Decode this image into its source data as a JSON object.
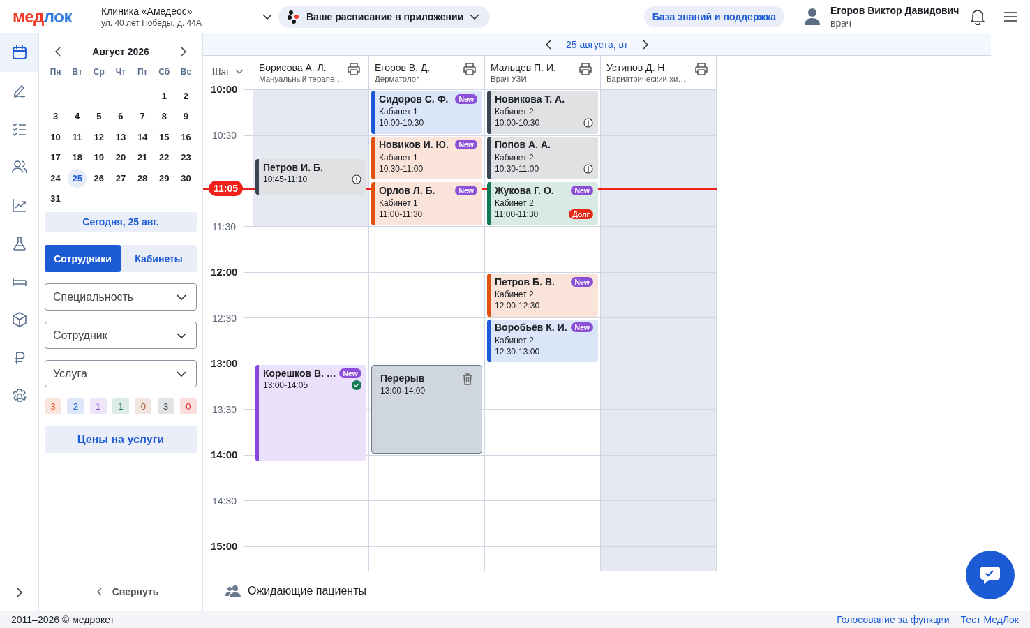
{
  "header": {
    "logo": {
      "first": "мед",
      "second": "лок"
    },
    "clinic": {
      "name": "Клиника «Амедеос»",
      "address": "ул. 40 лет Победы, д. 44А"
    },
    "app_promo": "Ваше расписание в приложении",
    "help": "База знаний и поддержка",
    "user": {
      "name": "Егоров Виктор Давидович",
      "role": "врач"
    }
  },
  "nav": [
    {
      "selected": true
    },
    {
      "selected": false
    },
    {
      "selected": false
    },
    {
      "selected": false
    },
    {
      "selected": false
    },
    {
      "selected": false
    },
    {
      "selected": false
    },
    {
      "selected": false
    },
    {
      "selected": false
    },
    {
      "selected": false
    }
  ],
  "calendar": {
    "month": "Август 2026",
    "weekdays": [
      "Пн",
      "Вт",
      "Ср",
      "Чт",
      "Пт",
      "Сб",
      "Вс"
    ],
    "weeks": [
      [
        {
          "day": "1",
          "selected": false
        },
        {
          "day": "2",
          "selected": false
        }
      ],
      [
        {
          "day": "3",
          "selected": false
        },
        {
          "day": "4",
          "selected": false
        },
        {
          "day": "5",
          "selected": false
        },
        {
          "day": "6",
          "selected": false
        },
        {
          "day": "7",
          "selected": false
        },
        {
          "day": "8",
          "selected": false
        },
        {
          "day": "9",
          "selected": false
        }
      ],
      [
        {
          "day": "10",
          "selected": false
        },
        {
          "day": "11",
          "selected": false
        },
        {
          "day": "12",
          "selected": false
        },
        {
          "day": "13",
          "selected": false
        },
        {
          "day": "14",
          "selected": false
        },
        {
          "day": "15",
          "selected": false
        },
        {
          "day": "16",
          "selected": false
        }
      ],
      [
        {
          "day": "17",
          "selected": false
        },
        {
          "day": "18",
          "selected": false
        },
        {
          "day": "19",
          "selected": false
        },
        {
          "day": "20",
          "selected": false
        },
        {
          "day": "21",
          "selected": false
        },
        {
          "day": "22",
          "selected": false
        },
        {
          "day": "23",
          "selected": false
        }
      ],
      [
        {
          "day": "24",
          "selected": false
        },
        {
          "day": "25",
          "selected": true
        },
        {
          "day": "26",
          "selected": false
        },
        {
          "day": "27",
          "selected": false
        },
        {
          "day": "28",
          "selected": false
        },
        {
          "day": "29",
          "selected": false
        },
        {
          "day": "30",
          "selected": false
        }
      ],
      [
        {
          "day": "31",
          "selected": false
        }
      ]
    ]
  },
  "today_button": "Сегодня, 25 авг.",
  "view_tabs": [
    {
      "label": "Сотрудники",
      "selected": true
    },
    {
      "label": "Кабинеты",
      "selected": false
    }
  ],
  "filters": [
    {
      "placeholder": "Специальность"
    },
    {
      "placeholder": "Сотрудник"
    },
    {
      "placeholder": "Услуга"
    }
  ],
  "counters": [
    {
      "value": "3",
      "color": "#e0531a"
    },
    {
      "value": "2",
      "color": "#1f5fd6"
    },
    {
      "value": "1",
      "color": "#8b4fd8"
    },
    {
      "value": "1",
      "color": "#1e7a4f"
    },
    {
      "value": "0",
      "color": "#a0522d"
    },
    {
      "value": "3",
      "color": "#3d4654"
    },
    {
      "value": "0",
      "color": "#e02424"
    }
  ],
  "prices_button": "Цены на услуги",
  "collapse": "Свернуть",
  "schedule": {
    "date": "25 августа, вт",
    "step": "Шаг",
    "now": "11:05",
    "times": [
      {
        "label": "10:00",
        "major": true
      },
      {
        "label": "10:30",
        "major": false
      },
      {
        "label": "11:30",
        "major": false
      },
      {
        "label": "12:00",
        "major": true
      },
      {
        "label": "12:30",
        "major": false
      },
      {
        "label": "13:00",
        "major": true
      },
      {
        "label": "13:30",
        "major": false
      },
      {
        "label": "14:00",
        "major": true
      },
      {
        "label": "14:30",
        "major": false
      },
      {
        "label": "15:00",
        "major": true
      }
    ],
    "columns": [
      {
        "name": "Борисова А. Л.",
        "specialty": "Мануальный терапе…",
        "unavailable": false,
        "late_start": true,
        "appointments": [
          {
            "kind": "visit",
            "name": "Петров И. Б.",
            "time": "10:45-11:10",
            "color": "#3a4452",
            "alert": true,
            "confirmed": false
          },
          {
            "kind": "visit",
            "name": "Корешков В. …",
            "time": "13:00-14:05",
            "color": "#8a46e0",
            "badge": "New",
            "alert": false,
            "confirmed": true
          }
        ]
      },
      {
        "name": "Егоров В. Д.",
        "specialty": "Дерматолог",
        "unavailable": false,
        "late_start": false,
        "appointments": [
          {
            "kind": "visit",
            "name": "Сидоров С. Ф.",
            "room": "Кабинет 1",
            "time": "10:00-10:30",
            "color": "#1d5bd6",
            "badge": "New",
            "alert": false,
            "confirmed": false
          },
          {
            "kind": "visit",
            "name": "Новиков И. Ю.",
            "room": "Кабинет 1",
            "time": "10:30-11:00",
            "color": "#e0530f",
            "badge": "New",
            "alert": false,
            "confirmed": false
          },
          {
            "kind": "visit",
            "name": "Орлов Л. Б.",
            "room": "Кабинет 1",
            "time": "11:00-11:30",
            "color": "#e0530f",
            "badge": "New",
            "alert": false,
            "confirmed": false
          },
          {
            "kind": "break",
            "name": "Перерыв",
            "time": "13:00-14:00"
          }
        ]
      },
      {
        "name": "Мальцев П. И.",
        "specialty": "Врач УЗИ",
        "unavailable": false,
        "late_start": false,
        "appointments": [
          {
            "kind": "visit",
            "name": "Новикова Т. А.",
            "room": "Кабинет 2",
            "time": "10:00-10:30",
            "color": "#3a4452",
            "alert": true,
            "confirmed": false
          },
          {
            "kind": "visit",
            "name": "Попов А. А.",
            "room": "Кабинет 2",
            "time": "10:30-11:00",
            "color": "#3a4452",
            "alert": true,
            "confirmed": false
          },
          {
            "kind": "visit",
            "name": "Жукова Г. О.",
            "room": "Кабинет 2",
            "time": "11:00-11:30",
            "color": "#0f7a55",
            "badge": "New",
            "debt": "Долг",
            "alert": false,
            "confirmed": false
          },
          {
            "kind": "visit",
            "name": "Петров Б. В.",
            "room": "Кабинет 2",
            "time": "12:00-12:30",
            "color": "#e0530f",
            "badge": "New",
            "alert": false,
            "confirmed": false
          },
          {
            "kind": "visit",
            "name": "Воробьёв К. И.",
            "room": "Кабинет 2",
            "time": "12:30-13:00",
            "color": "#1d5bd6",
            "badge": "New",
            "alert": false,
            "confirmed": false
          }
        ]
      },
      {
        "name": "Устинов Д. Н.",
        "specialty": "Бариатрический хи…",
        "unavailable": true,
        "late_start": false
      }
    ]
  },
  "waiting": "Ожидающие пациенты",
  "footer": {
    "copyright": "2011–2026 © медрокет",
    "links": [
      "Голосование за функции",
      "Тест МедЛок"
    ]
  }
}
